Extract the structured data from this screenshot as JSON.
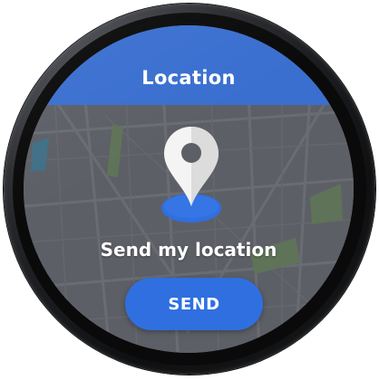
{
  "app": {
    "title": "Location"
  },
  "main": {
    "pin_icon": "location-pin-icon",
    "message": "Send my location",
    "send_label": "SEND"
  },
  "colors": {
    "header": "#3a6fd0",
    "button": "#2f6fe0",
    "map_background": "#5d5f66",
    "text": "#ffffff"
  }
}
